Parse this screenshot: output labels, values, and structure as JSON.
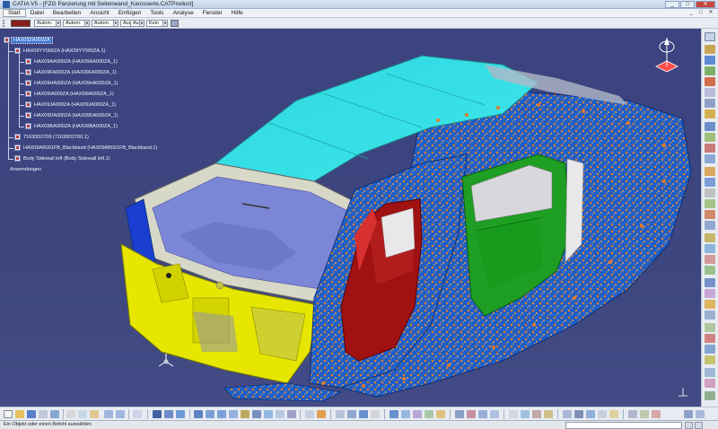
{
  "window": {
    "title": "CATIA V5 - [FZG Panzerung mit Seitenwand_Karosserie.CATProduct]",
    "buttons": [
      "_",
      "□",
      "✕"
    ]
  },
  "menu": {
    "items": [
      "Start",
      "Datei",
      "Bearbeiten",
      "Ansicht",
      "Einfügen",
      "Tools",
      "Analyse",
      "Fenster",
      "Hilfe"
    ],
    "mdi_buttons": [
      "_",
      "□",
      "✕"
    ]
  },
  "props_toolbar": {
    "color_value": "#8c1e1e",
    "fields": [
      "Autom.",
      "Autom.",
      "Autom.",
      "Aus",
      "Aus",
      "Kein"
    ]
  },
  "tree": {
    "root": "HAX09ZA000ZA",
    "sub_product": "HAX09YY000ZA (HAX09YY000ZA.1)",
    "parts": [
      "HAX09AA000ZA (HAX09AA000ZA_1)",
      "HAX09FA000ZA (HAX09FA000ZA_1)",
      "HAX09HA000ZA (HAX09HA000ZA_1)",
      "HAX09IA000ZA (HAX09IA000ZA_1)",
      "HAX09JA000ZA (HAX09JA000ZA_1)",
      "HAX09DA000ZA (HAX09DA000ZA_1)",
      "HAX09BA000ZA (HAX09BA000ZA_1)"
    ],
    "others": [
      "71630D2700 (71630D2700.1)",
      "HAX09AB001FB_Blackband (HAX09AB001FB_Blackband.1)",
      "Body Sidewall left (Body Sidewall left.1)"
    ],
    "applications": "Anwendungen"
  },
  "colors": {
    "roof": "#33e0e6",
    "glass": "#7b86d6",
    "body_blue": "#1f5fc8",
    "door_red": "#a01212",
    "door_green": "#1e9e22",
    "front_yellow": "#e6e600",
    "hardware_orange": "#e07a2a"
  },
  "status": {
    "message": "Ein Objekt oder einen Befehl auswählen"
  }
}
